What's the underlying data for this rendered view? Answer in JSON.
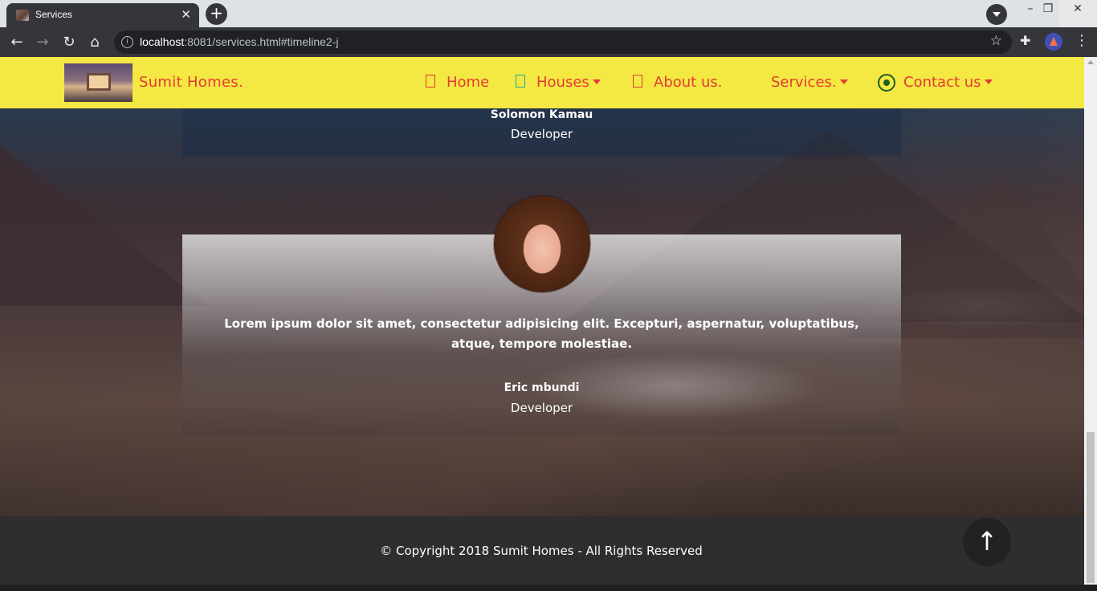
{
  "browser": {
    "tab_title": "Services",
    "url_host": "localhost",
    "url_rest": ":8081/services.html#timeline2-j",
    "new_tab": "+",
    "close": "✕"
  },
  "nav": {
    "brand": "Sumit Homes.",
    "items": [
      {
        "label": "Home",
        "dropdown": false
      },
      {
        "label": "Houses",
        "dropdown": true
      },
      {
        "label": "About us.",
        "dropdown": false
      },
      {
        "label": "Services.",
        "dropdown": true
      },
      {
        "label": "Contact us",
        "dropdown": true
      }
    ]
  },
  "testimonials": [
    {
      "name": "Solomon Kamau",
      "role": "Developer"
    },
    {
      "name": "Eric mbundi",
      "role": "Developer",
      "quote": "Lorem ipsum dolor sit amet, consectetur adipisicing elit. Excepturi, aspernatur, voluptatibus, atque, tempore molestiae."
    }
  ],
  "footer": {
    "copyright": "© Copyright 2018  Sumit Homes - All Rights Reserved",
    "to_top": "↑"
  },
  "colors": {
    "nav_bg": "#f4e842",
    "nav_text": "#e53935",
    "footer_bg": "#2e2e2e"
  }
}
